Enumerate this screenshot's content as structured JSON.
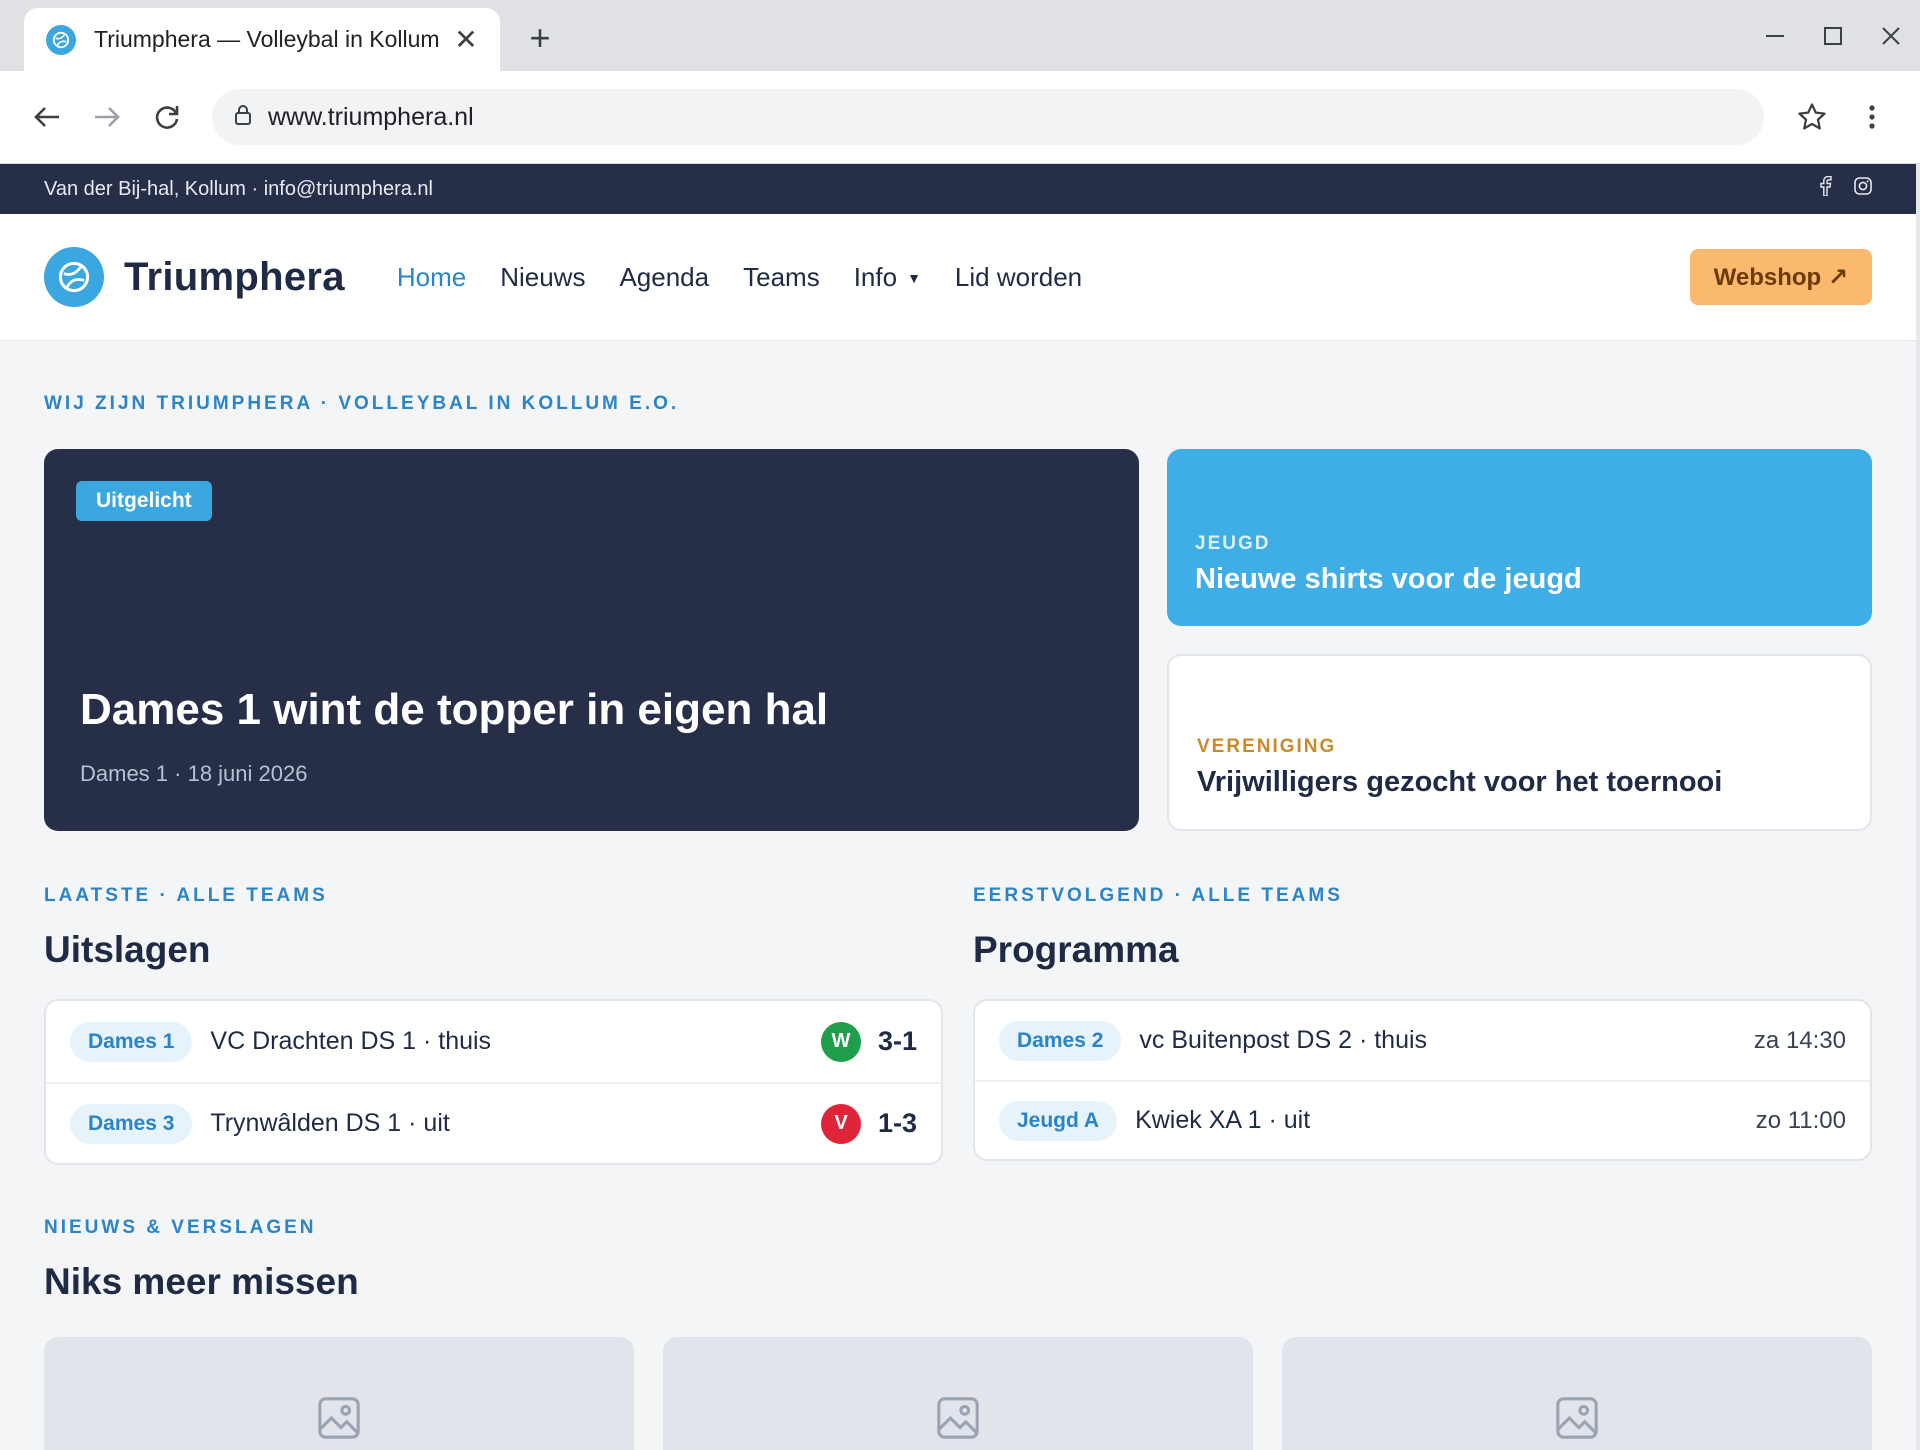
{
  "browser": {
    "tab_title": "Triumphera — Volleybal in Kollum",
    "url": "www.triumphera.nl"
  },
  "topbar": {
    "text": "Van der Bij-hal, Kollum · info@triumphera.nl",
    "social": [
      "facebook-icon",
      "instagram-icon"
    ]
  },
  "header": {
    "logo": "Triumphera",
    "nav": [
      "Home",
      "Nieuws",
      "Agenda",
      "Teams",
      "Info",
      "Lid worden"
    ],
    "webshop": "Webshop ↗"
  },
  "intro_eyebrow": "WIJ ZIJN TRIUMPHERA · VOLLEYBAL IN KOLLUM E.O.",
  "hero": {
    "badge": "Uitgelicht",
    "title": "Dames 1 wint de topper in eigen hal",
    "meta": "Dames 1 · 18 juni 2026"
  },
  "side_cards": [
    {
      "category": "JEUGD",
      "title": "Nieuwe shirts voor de jeugd"
    },
    {
      "category": "VERENIGING",
      "title": "Vrijwilligers gezocht voor het toernooi"
    }
  ],
  "results": {
    "eyebrow": "LAATSTE · ALLE TEAMS",
    "title": "Uitslagen",
    "rows": [
      {
        "team": "Dames 1",
        "match": "VC Drachten DS 1 · thuis",
        "outcome": "W",
        "score": "3-1"
      },
      {
        "team": "Dames 3",
        "match": "Trynwâlden DS 1 · uit",
        "outcome": "V",
        "score": "1-3"
      }
    ]
  },
  "schedule": {
    "eyebrow": "EERSTVOLGEND · ALLE TEAMS",
    "title": "Programma",
    "rows": [
      {
        "team": "Dames 2",
        "match": "vc Buitenpost DS 2 · thuis",
        "time": "za 14:30"
      },
      {
        "team": "Jeugd A",
        "match": "Kwiek XA 1 · uit",
        "time": "zo 11:00"
      }
    ]
  },
  "news": {
    "eyebrow": "NIEUWS & VERSLAGEN",
    "title": "Niks meer missen"
  },
  "colors": {
    "navy": "#262f47",
    "accent_blue": "#3aa7e0",
    "link_blue": "#2b84c7",
    "webshop_orange": "#fbb96e",
    "win_green": "#1e9d4b",
    "loss_red": "#e0243a"
  }
}
